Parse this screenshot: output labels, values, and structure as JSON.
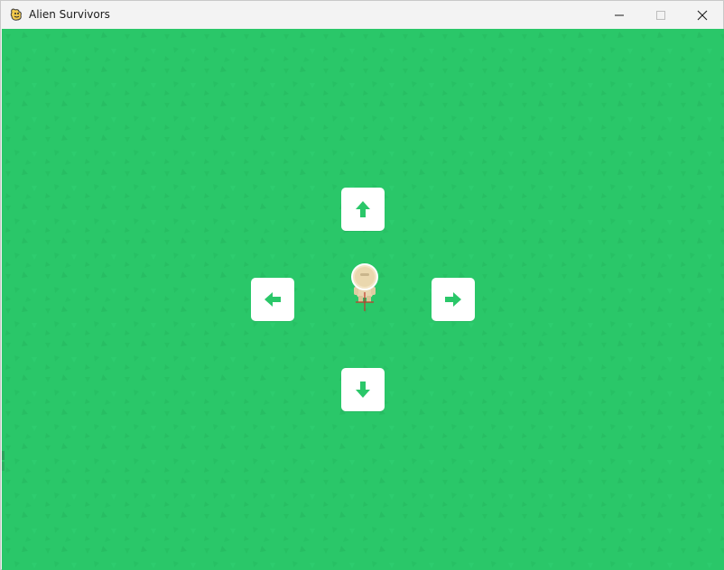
{
  "window": {
    "title": "Alien Survivors",
    "icon": "pygame-snake-icon",
    "controls": [
      "minimize-icon",
      "maximize-icon",
      "close-icon"
    ]
  },
  "game": {
    "background_color": "#2ac769",
    "key_color": "#ffffff",
    "arrow_color": "#2ac769",
    "direction_keys": [
      "up",
      "left",
      "right",
      "down"
    ],
    "player": "astronaut",
    "crosshair_color": "#c0392b"
  }
}
